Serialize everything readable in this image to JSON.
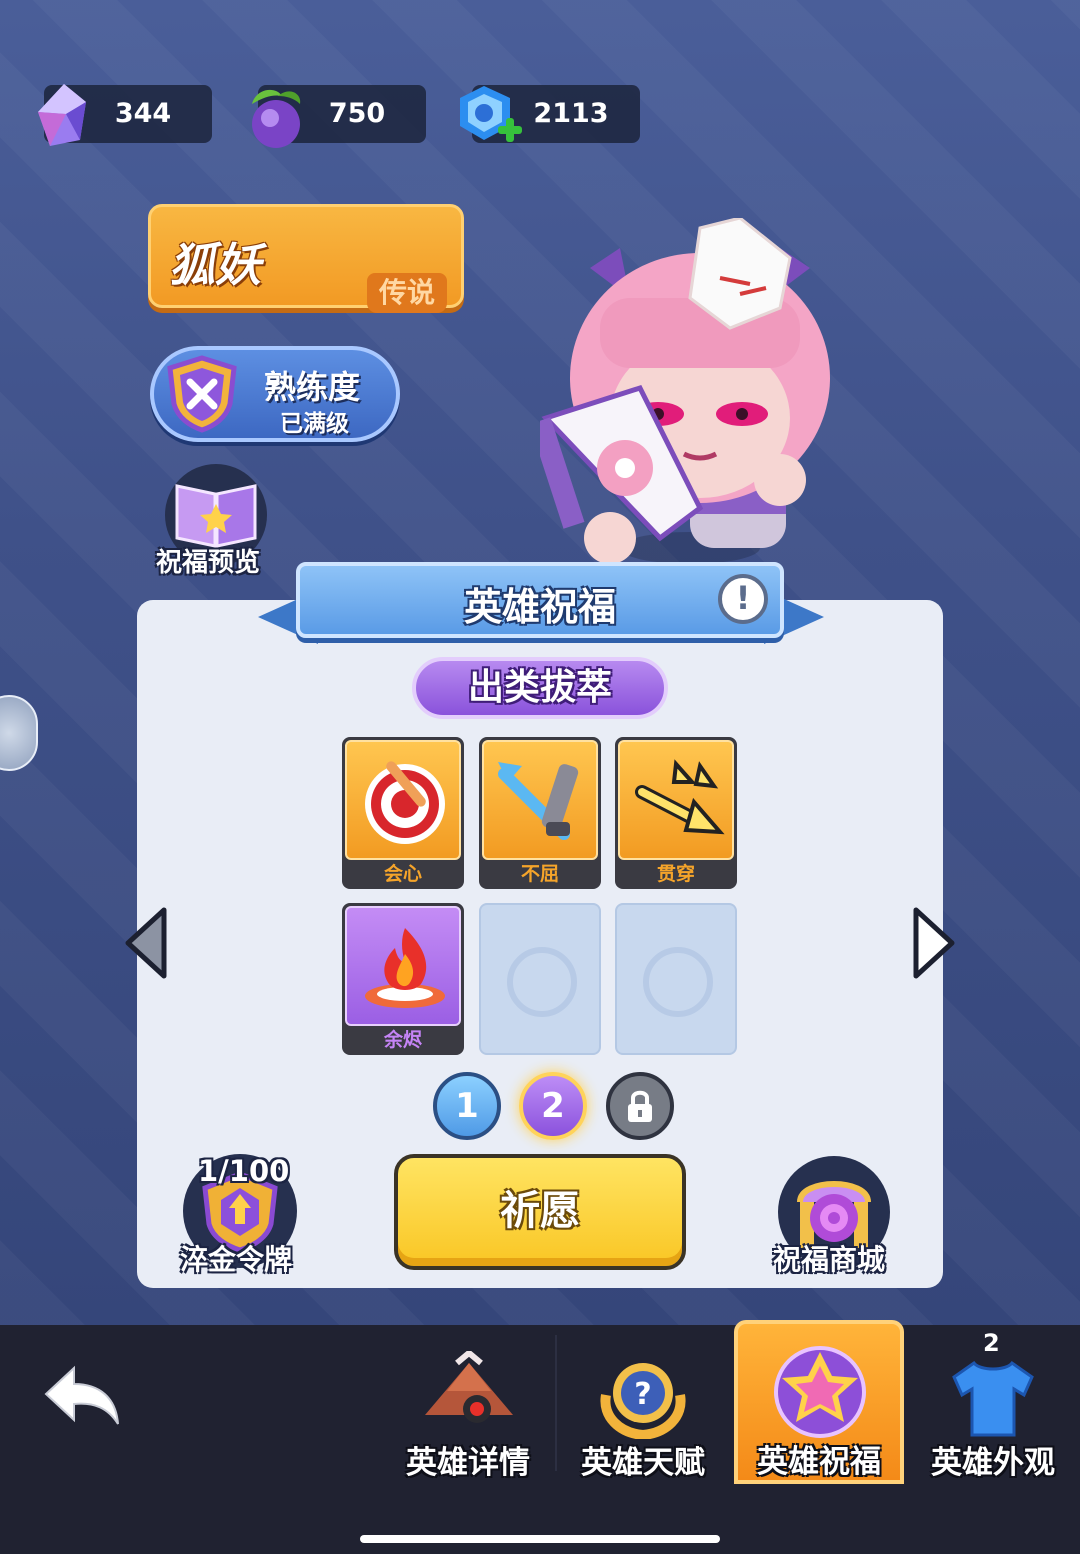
{
  "currencies": [
    {
      "icon": "crystal-icon",
      "value": "344"
    },
    {
      "icon": "fruit-icon",
      "value": "750"
    },
    {
      "icon": "blue-gem-icon",
      "value": "2113"
    }
  ],
  "hero": {
    "name": "狐妖",
    "rarity": "传说"
  },
  "mastery": {
    "title": "熟练度",
    "status": "已满级"
  },
  "preview": {
    "label": "祝福预览"
  },
  "panel": {
    "title": "英雄祝福",
    "tier": "出类拔萃",
    "cards": [
      {
        "label": "会心",
        "rarity": "gold",
        "icon": "target-icon"
      },
      {
        "label": "不屈",
        "rarity": "gold",
        "icon": "sword-icon"
      },
      {
        "label": "贯穿",
        "rarity": "gold",
        "icon": "arrows-icon"
      },
      {
        "label": "余烬",
        "rarity": "purple",
        "icon": "flame-icon"
      }
    ],
    "pages": [
      "1",
      "2"
    ]
  },
  "token": {
    "count": "1/100",
    "label": "淬金令牌"
  },
  "pray": {
    "label": "祈愿"
  },
  "shop": {
    "label": "祝福商城"
  },
  "nav": {
    "tabs": [
      {
        "label": "英雄详情"
      },
      {
        "label": "英雄天赋"
      },
      {
        "label": "英雄祝福"
      },
      {
        "label": "英雄外观",
        "badge": "2"
      }
    ]
  },
  "colors": {
    "background": "#3c4d82",
    "gold_card": "#f29b22",
    "purple_card": "#9b5fe4",
    "active_tab": "#f48a18"
  }
}
